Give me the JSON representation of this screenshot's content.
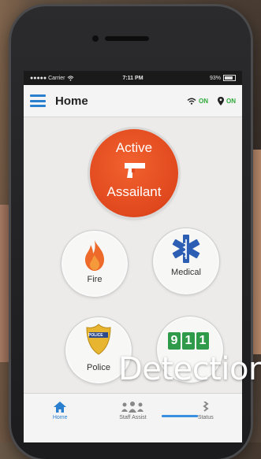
{
  "status_bar": {
    "carrier": "●●●●● Carrier",
    "time": "7:11 PM",
    "battery": "93%"
  },
  "nav": {
    "title": "Home",
    "wifi_status": "ON",
    "location_status": "ON"
  },
  "buttons": {
    "active_line1": "Active",
    "active_line2": "Assailant",
    "fire": "Fire",
    "medical": "Medical",
    "police_badge": "POLICE",
    "police": "Police",
    "digits": [
      "9",
      "1",
      "1"
    ]
  },
  "tabs": {
    "home": "Home",
    "staff_assist": "Staff Assist",
    "status": "Status"
  },
  "overlay": {
    "caption": "Detection"
  },
  "colors": {
    "accent": "#2b7fcf",
    "active_button": "#e34c21",
    "on_status": "#2fa83a",
    "nine11_green": "#2f9a4a"
  }
}
